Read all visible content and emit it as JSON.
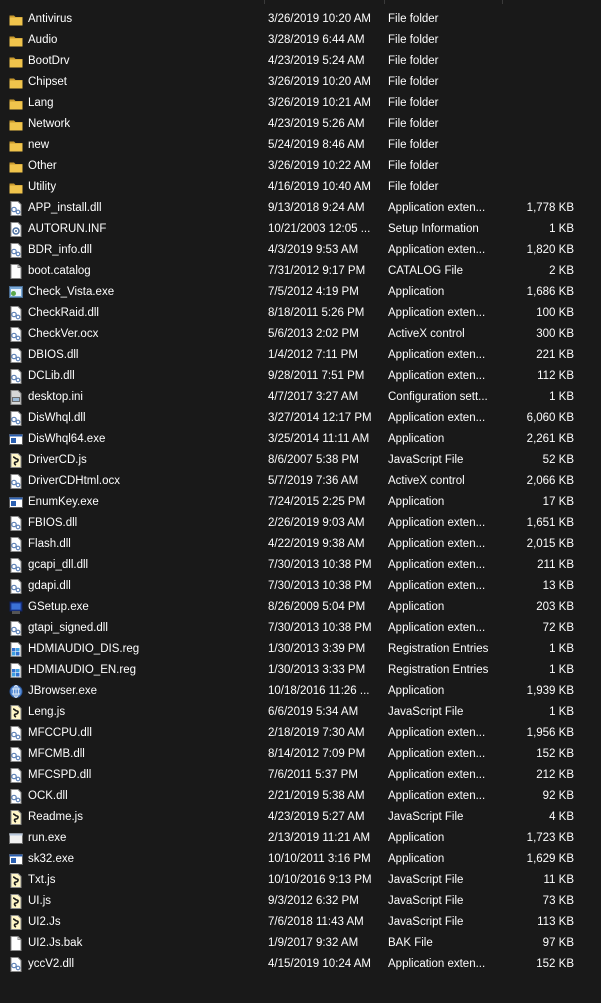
{
  "files": [
    {
      "name": "Antivirus",
      "date": "3/26/2019 10:20 AM",
      "type": "File folder",
      "size": "",
      "icon": "folder-icon"
    },
    {
      "name": "Audio",
      "date": "3/28/2019 6:44 AM",
      "type": "File folder",
      "size": "",
      "icon": "folder-icon"
    },
    {
      "name": "BootDrv",
      "date": "4/23/2019 5:24 AM",
      "type": "File folder",
      "size": "",
      "icon": "folder-icon"
    },
    {
      "name": "Chipset",
      "date": "3/26/2019 10:20 AM",
      "type": "File folder",
      "size": "",
      "icon": "folder-icon"
    },
    {
      "name": "Lang",
      "date": "3/26/2019 10:21 AM",
      "type": "File folder",
      "size": "",
      "icon": "folder-icon"
    },
    {
      "name": "Network",
      "date": "4/23/2019 5:26 AM",
      "type": "File folder",
      "size": "",
      "icon": "folder-icon"
    },
    {
      "name": "new",
      "date": "5/24/2019 8:46 AM",
      "type": "File folder",
      "size": "",
      "icon": "folder-icon"
    },
    {
      "name": "Other",
      "date": "3/26/2019 10:22 AM",
      "type": "File folder",
      "size": "",
      "icon": "folder-icon"
    },
    {
      "name": "Utility",
      "date": "4/16/2019 10:40 AM",
      "type": "File folder",
      "size": "",
      "icon": "folder-icon"
    },
    {
      "name": "APP_install.dll",
      "date": "9/13/2018 9:24 AM",
      "type": "Application exten...",
      "size": "1,778 KB",
      "icon": "dll-icon"
    },
    {
      "name": "AUTORUN.INF",
      "date": "10/21/2003 12:05 ...",
      "type": "Setup Information",
      "size": "1 KB",
      "icon": "inf-icon"
    },
    {
      "name": "BDR_info.dll",
      "date": "4/3/2019 9:53 AM",
      "type": "Application exten...",
      "size": "1,820 KB",
      "icon": "dll-icon"
    },
    {
      "name": "boot.catalog",
      "date": "7/31/2012 9:17 PM",
      "type": "CATALOG File",
      "size": "2 KB",
      "icon": "file-icon"
    },
    {
      "name": "Check_Vista.exe",
      "date": "7/5/2012 4:19 PM",
      "type": "Application",
      "size": "1,686 KB",
      "icon": "app-icon"
    },
    {
      "name": "CheckRaid.dll",
      "date": "8/18/2011 5:26 PM",
      "type": "Application exten...",
      "size": "100 KB",
      "icon": "dll-icon"
    },
    {
      "name": "CheckVer.ocx",
      "date": "5/6/2013 2:02 PM",
      "type": "ActiveX control",
      "size": "300 KB",
      "icon": "dll-icon"
    },
    {
      "name": "DBIOS.dll",
      "date": "1/4/2012 7:11 PM",
      "type": "Application exten...",
      "size": "221 KB",
      "icon": "dll-icon"
    },
    {
      "name": "DCLib.dll",
      "date": "9/28/2011 7:51 PM",
      "type": "Application exten...",
      "size": "112 KB",
      "icon": "dll-icon"
    },
    {
      "name": "desktop.ini",
      "date": "4/7/2017 3:27 AM",
      "type": "Configuration sett...",
      "size": "1 KB",
      "icon": "ini-icon"
    },
    {
      "name": "DisWhql.dll",
      "date": "3/27/2014 12:17 PM",
      "type": "Application exten...",
      "size": "6,060 KB",
      "icon": "dll-icon"
    },
    {
      "name": "DisWhql64.exe",
      "date": "3/25/2014 11:11 AM",
      "type": "Application",
      "size": "2,261 KB",
      "icon": "exe-icon"
    },
    {
      "name": "DriverCD.js",
      "date": "8/6/2007 5:38 PM",
      "type": "JavaScript File",
      "size": "52 KB",
      "icon": "js-icon"
    },
    {
      "name": "DriverCDHtml.ocx",
      "date": "5/7/2019 7:36 AM",
      "type": "ActiveX control",
      "size": "2,066 KB",
      "icon": "dll-icon"
    },
    {
      "name": "EnumKey.exe",
      "date": "7/24/2015 2:25 PM",
      "type": "Application",
      "size": "17 KB",
      "icon": "exe-icon"
    },
    {
      "name": "FBIOS.dll",
      "date": "2/26/2019 9:03 AM",
      "type": "Application exten...",
      "size": "1,651 KB",
      "icon": "dll-icon"
    },
    {
      "name": "Flash.dll",
      "date": "4/22/2019 9:38 AM",
      "type": "Application exten...",
      "size": "2,015 KB",
      "icon": "dll-icon"
    },
    {
      "name": "gcapi_dll.dll",
      "date": "7/30/2013 10:38 PM",
      "type": "Application exten...",
      "size": "211 KB",
      "icon": "dll-icon"
    },
    {
      "name": "gdapi.dll",
      "date": "7/30/2013 10:38 PM",
      "type": "Application exten...",
      "size": "13 KB",
      "icon": "dll-icon"
    },
    {
      "name": "GSetup.exe",
      "date": "8/26/2009 5:04 PM",
      "type": "Application",
      "size": "203 KB",
      "icon": "setup-icon"
    },
    {
      "name": "gtapi_signed.dll",
      "date": "7/30/2013 10:38 PM",
      "type": "Application exten...",
      "size": "72 KB",
      "icon": "dll-icon"
    },
    {
      "name": "HDMIAUDIO_DIS.reg",
      "date": "1/30/2013 3:39 PM",
      "type": "Registration Entries",
      "size": "1 KB",
      "icon": "reg-icon"
    },
    {
      "name": "HDMIAUDIO_EN.reg",
      "date": "1/30/2013 3:33 PM",
      "type": "Registration Entries",
      "size": "1 KB",
      "icon": "reg-icon"
    },
    {
      "name": "JBrowser.exe",
      "date": "10/18/2016 11:26 ...",
      "type": "Application",
      "size": "1,939 KB",
      "icon": "browser-icon"
    },
    {
      "name": "Leng.js",
      "date": "6/6/2019 5:34 AM",
      "type": "JavaScript File",
      "size": "1 KB",
      "icon": "js-icon"
    },
    {
      "name": "MFCCPU.dll",
      "date": "2/18/2019 7:30 AM",
      "type": "Application exten...",
      "size": "1,956 KB",
      "icon": "dll-icon"
    },
    {
      "name": "MFCMB.dll",
      "date": "8/14/2012 7:09 PM",
      "type": "Application exten...",
      "size": "152 KB",
      "icon": "dll-icon"
    },
    {
      "name": "MFCSPD.dll",
      "date": "7/6/2011 5:37 PM",
      "type": "Application exten...",
      "size": "212 KB",
      "icon": "dll-icon"
    },
    {
      "name": "OCK.dll",
      "date": "2/21/2019 5:38 AM",
      "type": "Application exten...",
      "size": "92 KB",
      "icon": "dll-icon"
    },
    {
      "name": "Readme.js",
      "date": "4/23/2019 5:27 AM",
      "type": "JavaScript File",
      "size": "4 KB",
      "icon": "js-icon"
    },
    {
      "name": "run.exe",
      "date": "2/13/2019 11:21 AM",
      "type": "Application",
      "size": "1,723 KB",
      "icon": "blank-exe-icon"
    },
    {
      "name": "sk32.exe",
      "date": "10/10/2011 3:16 PM",
      "type": "Application",
      "size": "1,629 KB",
      "icon": "exe-icon"
    },
    {
      "name": "Txt.js",
      "date": "10/10/2016 9:13 PM",
      "type": "JavaScript File",
      "size": "11 KB",
      "icon": "js-icon"
    },
    {
      "name": "UI.js",
      "date": "9/3/2012 6:32 PM",
      "type": "JavaScript File",
      "size": "73 KB",
      "icon": "js-icon"
    },
    {
      "name": "UI2.Js",
      "date": "7/6/2018 11:43 AM",
      "type": "JavaScript File",
      "size": "113 KB",
      "icon": "js-icon"
    },
    {
      "name": "UI2.Js.bak",
      "date": "1/9/2017 9:32 AM",
      "type": "BAK File",
      "size": "97 KB",
      "icon": "file-icon"
    },
    {
      "name": "yccV2.dll",
      "date": "4/15/2019 10:24 AM",
      "type": "Application exten...",
      "size": "152 KB",
      "icon": "dll-icon"
    }
  ],
  "colors": {
    "background": "#191919",
    "text": "#ffffff",
    "folder": "#e8c048",
    "separator": "#3a3a3a"
  }
}
